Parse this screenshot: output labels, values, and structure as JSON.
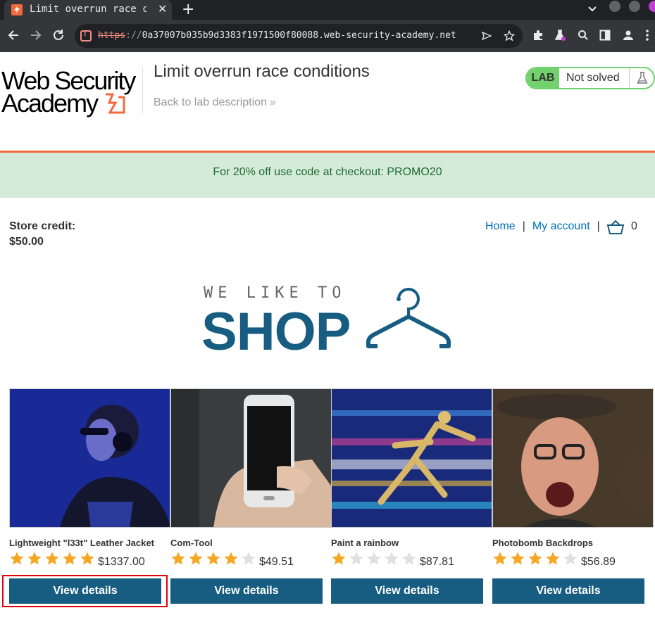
{
  "browser": {
    "tab_title": "Limit overrun race c",
    "url_scheme": "https",
    "url_sep": "://",
    "url_host": "0a37007b035b9d3383f1971500f80088.web-security-academy.net",
    "new_tab": "+",
    "tab_close": "✕"
  },
  "header": {
    "logo_line1": "Web Security",
    "logo_line2": "Academy",
    "lab_title": "Limit overrun race conditions",
    "back_link": "Back to lab description",
    "back_chevron": "»",
    "lab_badge": "LAB",
    "lab_state": "Not solved"
  },
  "promo": "For 20% off use code at checkout: PROMO20",
  "account": {
    "store_credit_label": "Store credit:",
    "store_credit_value": "$50.00",
    "home": "Home",
    "separator": "|",
    "my_account": "My account",
    "cart_count": "0"
  },
  "hero": {
    "small": "WE LIKE TO",
    "big": "SHOP"
  },
  "products": [
    {
      "name": "Lightweight \"l33t\" Leather Jacket",
      "rating": 5,
      "price": "$1337.00",
      "button": "View details",
      "image": "person-headphones"
    },
    {
      "name": "Com-Tool",
      "rating": 4,
      "price": "$49.51",
      "button": "View details",
      "image": "hand-smartphone"
    },
    {
      "name": "Paint a rainbow",
      "rating": 1,
      "price": "$87.81",
      "button": "View details",
      "image": "neon-runner"
    },
    {
      "name": "Photobomb Backdrops",
      "rating": 4,
      "price": "$56.89",
      "button": "View details",
      "image": "man-monkey"
    }
  ],
  "colors": {
    "brand_blue": "#175d82",
    "accent_orange": "#f26a3a",
    "lab_green": "#70d16d",
    "star_gold": "#f5a623",
    "star_empty": "#e0e0e0",
    "highlight_red": "#e3000b"
  }
}
